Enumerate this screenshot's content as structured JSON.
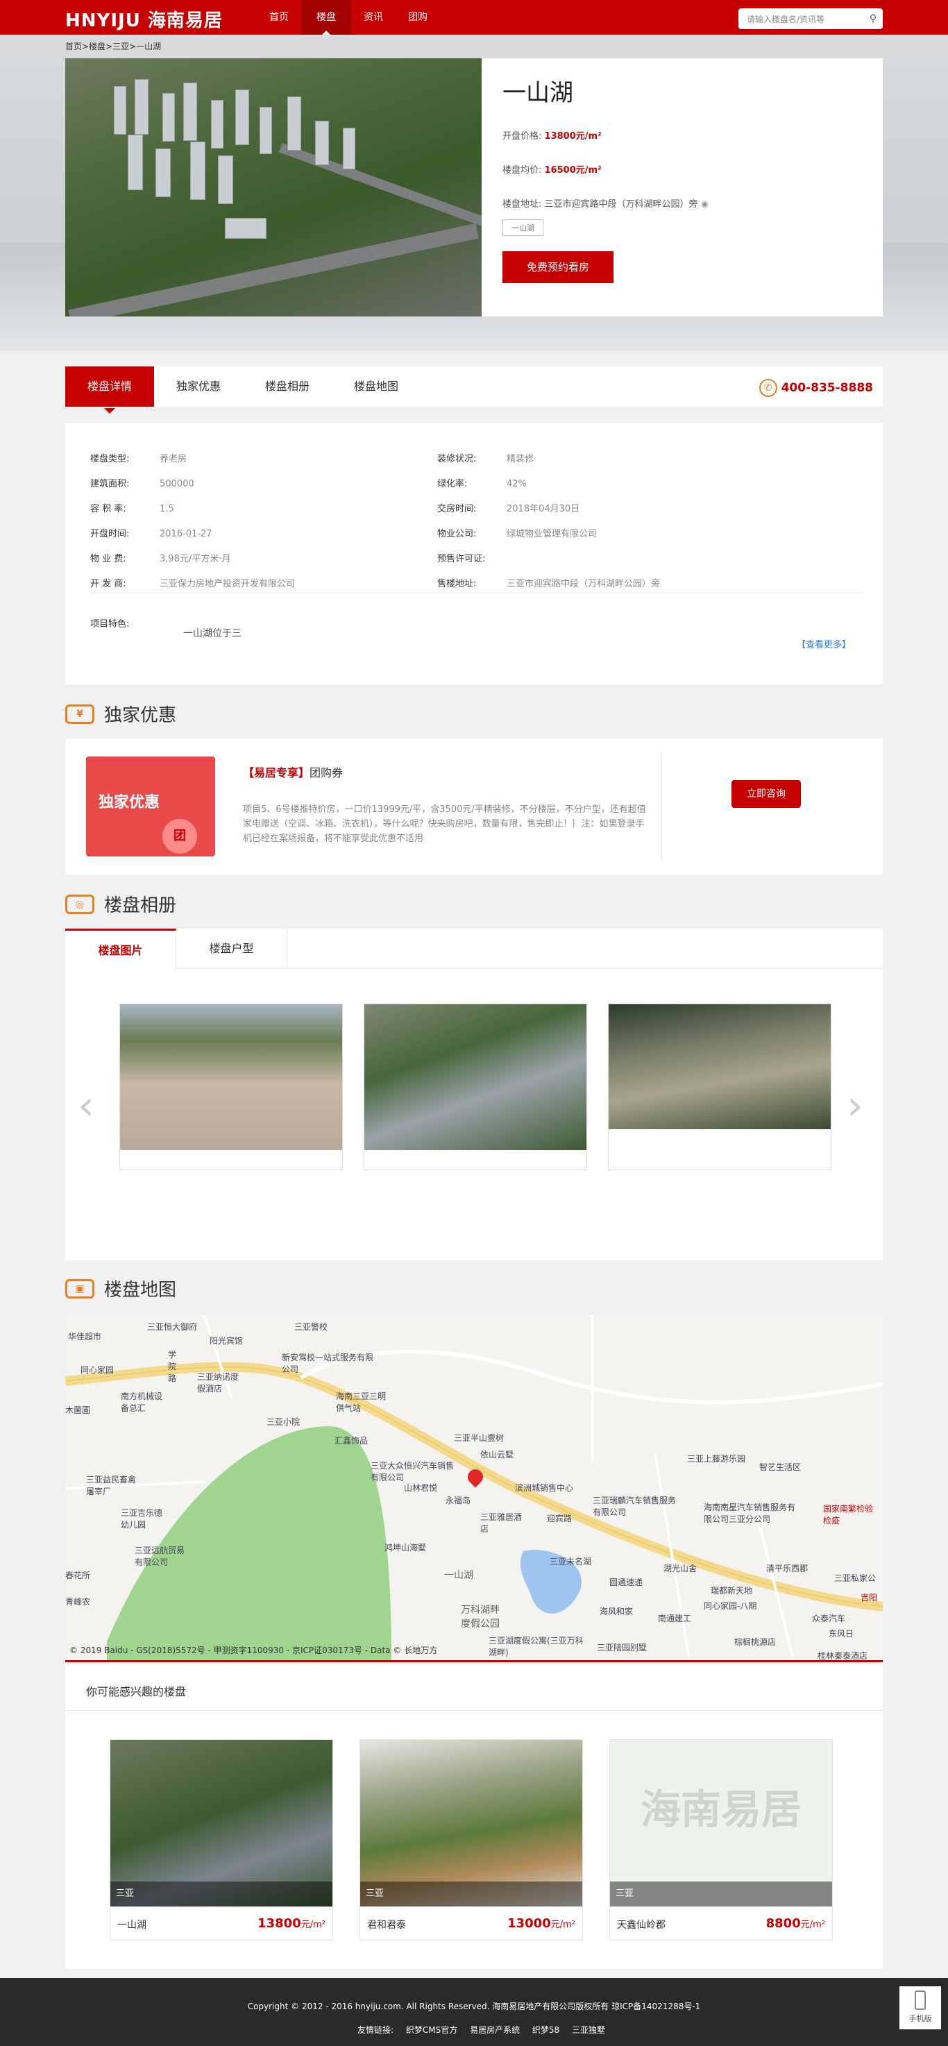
{
  "header": {
    "logo": "HNYIJU 海南易居",
    "nav": [
      "首页",
      "楼盘",
      "资讯",
      "团购"
    ],
    "search_placeholder": "请输入楼盘名/资讯等"
  },
  "breadcrumb": "首页>楼盘>三亚>一山湖",
  "project": {
    "name": "一山湖",
    "open_price_label": "开盘价格:",
    "open_price": "13800元/m²",
    "avg_price_label": "楼盘均价:",
    "avg_price": "16500元/m²",
    "address_label": "楼盘地址:",
    "address": "三亚市迎宾路中段（万科湖畔公园）旁",
    "tag": "一山湖",
    "cta": "免费预约看房"
  },
  "tabs": {
    "items": [
      "楼盘详情",
      "独家优惠",
      "楼盘相册",
      "楼盘地图"
    ],
    "phone": "400-835-8888"
  },
  "detail": {
    "left": [
      [
        "楼盘类型:",
        "养老房"
      ],
      [
        "建筑面积:",
        "500000"
      ],
      [
        "容 积 率:",
        "1.5"
      ],
      [
        "开盘时间:",
        "2016-01-27"
      ],
      [
        "物 业 费:",
        "3.98元/平方米·月"
      ],
      [
        "开 发 商:",
        "三亚保力房地产投资开发有限公司"
      ]
    ],
    "right": [
      [
        "装修状况:",
        "精装修"
      ],
      [
        "绿化率:",
        "42%"
      ],
      [
        "交房时间:",
        "2018年04月30日"
      ],
      [
        "物业公司:",
        "绿城物业管理有限公司"
      ],
      [
        "预售许可证:",
        ""
      ],
      [
        "售楼地址:",
        "三亚市迎宾路中段（万科湖畔公园）旁"
      ]
    ],
    "feature_label": "项目特色:",
    "feature": "一山湖位于三",
    "more": "【查看更多】"
  },
  "promo": {
    "heading": "独家优惠",
    "coupon_text": "独家优惠",
    "coupon_badge": "团",
    "title_tag": "【易居专享】",
    "title": "团购券",
    "desc": "项目5、6号楼推特价房，一口价13999元/平，含3500元/平精装修，不分楼层，不分户型，还有超值家电赠送（空调、冰箱、洗衣机），等什么呢？快来购房吧，数量有限，售完即止！｝注：如果登录手机已经在案场报备，将不能享受此优惠不适用",
    "button": "立即咨询"
  },
  "album": {
    "heading": "楼盘相册",
    "tabs": [
      "楼盘图片",
      "楼盘户型"
    ]
  },
  "map": {
    "heading": "楼盘地图",
    "labels": [
      "华佳超市",
      "三亚恒大御府",
      "阳光宾馆",
      "三亚警校",
      "学院路",
      "新安驾校一站式服务有限公司",
      "三亚纳诺度假酒店",
      "同心家园",
      "南方机械设备总汇",
      "木菌圃",
      "海南三亚三明供气站",
      "三亚小院",
      "三亚半山壹树",
      "依山云墅",
      "汇鑫饰品",
      "三亚大众恒兴汽车销售有限公司",
      "山林君悦",
      "永福岛",
      "滨洲城销售中心",
      "三亚上藤游乐园",
      "智艺生活区",
      "三亚益民畜禽屠宰厂",
      "三亚吉乐德幼儿园",
      "三亚远航贸易有限公司",
      "三亚雅居酒店",
      "海南南星汽车销售服务有限公司三亚分公司",
      "迎宾路",
      "三亚瑞麟汽车销售服务有限公司",
      "国家南繁检验检疫",
      "鸿坤山海墅",
      "三亚未名湖",
      "湖光山舍",
      "一山湖",
      "圆通速递",
      "瑞都新天地",
      "海风和家",
      "南通建工",
      "万科湖畔度假公园",
      "三亚湖度假公寓(三亚万科湖畔)",
      "清平乐西郡",
      "同心家园-八期",
      "三亚私家公",
      "吉阳",
      "众泰汽车",
      "东风日",
      "三亚陆园别墅",
      "棕榈桃源店",
      "桂林秦泰酒店",
      "春花所",
      "青峰农"
    ],
    "copyright": "© 2019 Baidu - GS(2018)5572号 - 甲测资字1100930 - 京ICP证030173号 - Data © 长地万方"
  },
  "likes": {
    "title": "你可能感兴趣的楼盘",
    "items": [
      {
        "city": "三亚",
        "name": "一山湖",
        "price": "13800",
        "unit": "元/m²"
      },
      {
        "city": "三亚",
        "name": "君和君泰",
        "price": "13000",
        "unit": "元/m²"
      },
      {
        "city": "三亚",
        "name": "天鑫仙岭郡",
        "price": "8800",
        "unit": "元/m²"
      }
    ],
    "placeholder_logo": "海南易居"
  },
  "footer": {
    "copyright": "Copyright © 2012 - 2016 hnyiju.com. All Rights Reserved. 海南易居地产有限公司版权所有 琼ICP备14021288号-1",
    "links_label": "友情链接:",
    "links": [
      "织梦CMS官方",
      "易居房产系统",
      "织梦58",
      "三亚独墅"
    ],
    "mobile": "手机版"
  },
  "colors": {
    "brand": "#c60000",
    "accent": "#e67e22"
  }
}
